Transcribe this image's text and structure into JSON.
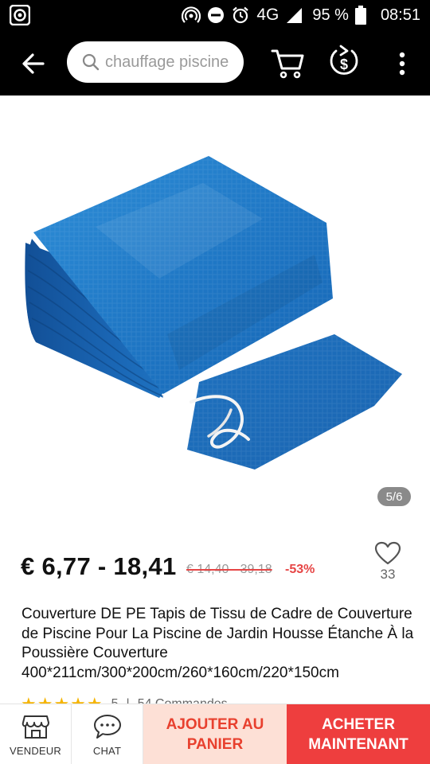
{
  "status_bar": {
    "network": "4G",
    "battery": "95 %",
    "time": "08:51"
  },
  "search": {
    "placeholder": "chauffage piscine"
  },
  "gallery": {
    "counter": "5/6"
  },
  "product": {
    "price": "€ 6,77 - 18,41",
    "original_price": "€ 14,40 - 39,18",
    "discount": "-53%",
    "wishlist_count": "33",
    "title": "Couverture DE PE Tapis de Tissu de Cadre de Couverture de Piscine Pour La Piscine de Jardin Housse Étanche À la Poussière Couverture 400*211cm/300*200cm/260*160cm/220*150cm",
    "rating": "5",
    "orders": "54 Commandes"
  },
  "bottom_bar": {
    "vendor_label": "VENDEUR",
    "chat_label": "CHAT",
    "add_to_cart_label": "AJOUTER AU PANIER",
    "buy_now_label": "ACHETER MAINTENANT"
  },
  "colors": {
    "accent": "#ee3e3e",
    "cart_bg": "#fde0d6",
    "discount": "#e64545",
    "star": "#f5b400"
  }
}
